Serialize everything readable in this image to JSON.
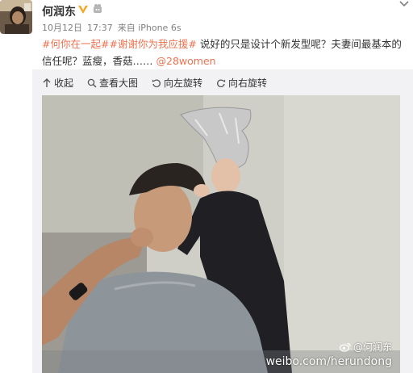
{
  "author": {
    "name": "何润东",
    "verified_icon": "verified-badge-icon",
    "member_icon": "member-icon"
  },
  "meta": {
    "date": "10月12日",
    "time": "17:37",
    "source": "来自 iPhone 6s"
  },
  "post": {
    "hashtag_1": "#何你在一起#",
    "hashtag_2": "#谢谢你为我应援#",
    "text": " 说好的只是设计个新发型呢？夫妻间最基本的信任呢？蓝瘦，香菇……",
    "mention": "@28women"
  },
  "toolbar": {
    "collapse_label": "收起",
    "view_large_label": "查看大图",
    "rotate_left_label": "向左旋转",
    "rotate_right_label": "向右旋转"
  },
  "photo": {
    "watermark_handle": "@何润东",
    "watermark_url": "weibo.com/herundong"
  },
  "colors": {
    "link": "#eb7350",
    "verified": "#f5a623",
    "card_bg": "#f2f2f5"
  }
}
